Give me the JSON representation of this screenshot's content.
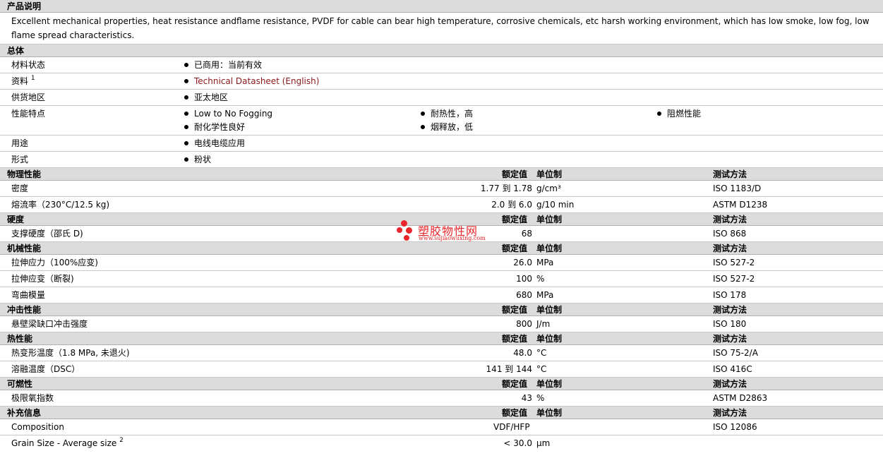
{
  "desc_header": "产品说明",
  "description": "Excellent mechanical properties, heat resistance andflame resistance, PVDF for cable can bear high temperature, corrosive chemicals, etc harsh working environment, which has low smoke, low fog, low flame spread characteristics.",
  "general": {
    "header": "总体",
    "rows": [
      {
        "label": "材料状态",
        "items": [
          "已商用：当前有效"
        ]
      },
      {
        "label": "资料",
        "sup": "1",
        "items": [
          "Technical Datasheet (English)"
        ]
      },
      {
        "label": "供货地区",
        "items": [
          "亚太地区"
        ]
      },
      {
        "label": "性能特点",
        "items": [
          "Low to No Fogging",
          "耐热性，高",
          "阻燃性能",
          "耐化学性良好",
          "烟释放，低"
        ]
      },
      {
        "label": "用途",
        "items": [
          "电线电缆应用"
        ]
      },
      {
        "label": "形式",
        "items": [
          "粉状"
        ]
      }
    ]
  },
  "col_headers": {
    "value": "额定值",
    "unit": "单位制",
    "test": "测试方法"
  },
  "physical": {
    "header": "物理性能",
    "rows": [
      {
        "label": "密度",
        "value": "1.77 到  1.78",
        "unit": "g/cm³",
        "test": "ISO 1183/D"
      },
      {
        "label": "熔流率（230°C/12.5 kg)",
        "value": "2.0 到  6.0",
        "unit": "g/10 min",
        "test": "ASTM D1238"
      }
    ]
  },
  "hardness": {
    "header": "硬度",
    "rows": [
      {
        "label": "支撑硬度（邵氏 D)",
        "value": "68",
        "unit": "",
        "test": "ISO 868"
      }
    ]
  },
  "mechanical": {
    "header": "机械性能",
    "rows": [
      {
        "label": "拉伸应力（100%应变)",
        "value": "26.0",
        "unit": "MPa",
        "test": "ISO 527-2"
      },
      {
        "label": "拉伸应变（断裂)",
        "value": "100",
        "unit": "%",
        "test": "ISO 527-2"
      },
      {
        "label": "弯曲模量",
        "value": "680",
        "unit": "MPa",
        "test": "ISO 178"
      }
    ]
  },
  "impact": {
    "header": "冲击性能",
    "rows": [
      {
        "label": "悬壁梁缺口冲击强度",
        "value": "800",
        "unit": "J/m",
        "test": "ISO 180"
      }
    ]
  },
  "thermal": {
    "header": "热性能",
    "rows": [
      {
        "label": "热变形温度（1.8 MPa, 未退火)",
        "value": "48.0",
        "unit": "°C",
        "test": "ISO 75-2/A"
      },
      {
        "label": "溶融温度（DSC）",
        "value": "141 到  144",
        "unit": "°C",
        "test": "ISO 416C"
      }
    ]
  },
  "flammability": {
    "header": "可燃性",
    "rows": [
      {
        "label": "极限氧指数",
        "value": "43",
        "unit": "%",
        "test": "ASTM D2863"
      }
    ]
  },
  "supplementary": {
    "header": "补充信息",
    "rows": [
      {
        "label": "Composition",
        "mid": "VDF/HFP",
        "test": "ISO 12086"
      },
      {
        "label": "Grain Size - Average size",
        "sup": "2",
        "value": "< 30.0",
        "unit": "µm",
        "test": ""
      }
    ]
  },
  "watermark": {
    "title": "塑胶物性网",
    "url": "www.sujiaowuxing.com"
  },
  "colors": {
    "header_bg": "#dcdcdc",
    "link": "#8b1a1a",
    "watermark": "#e8262b"
  }
}
